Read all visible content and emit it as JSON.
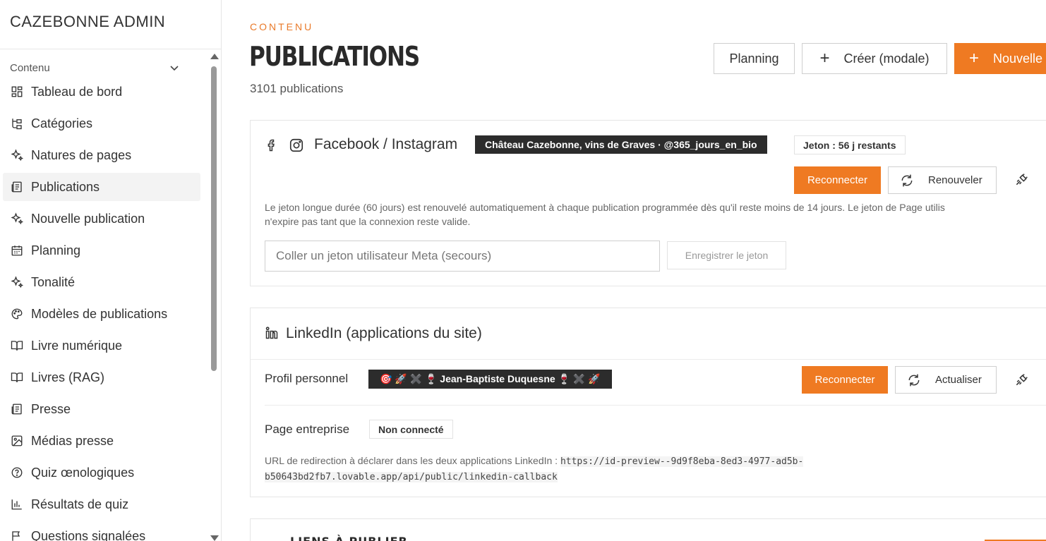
{
  "sidebar": {
    "brand": "CAZEBONNE ADMIN",
    "group_label": "Contenu",
    "items": [
      {
        "label": "Tableau de bord",
        "icon": "dashboard-icon"
      },
      {
        "label": "Catégories",
        "icon": "tree-icon"
      },
      {
        "label": "Natures de pages",
        "icon": "sparkles-icon"
      },
      {
        "label": "Publications",
        "icon": "newspaper-icon",
        "active": true
      },
      {
        "label": "Nouvelle publication",
        "icon": "sparkles-icon"
      },
      {
        "label": "Planning",
        "icon": "calendar-icon"
      },
      {
        "label": "Tonalité",
        "icon": "sparkles-icon"
      },
      {
        "label": "Modèles de publications",
        "icon": "palette-icon"
      },
      {
        "label": "Livre numérique",
        "icon": "book-icon"
      },
      {
        "label": "Livres (RAG)",
        "icon": "book-icon"
      },
      {
        "label": "Presse",
        "icon": "newspaper-icon"
      },
      {
        "label": "Médias presse",
        "icon": "image-icon"
      },
      {
        "label": "Quiz œnologiques",
        "icon": "help-circle-icon"
      },
      {
        "label": "Résultats de quiz",
        "icon": "bar-chart-icon"
      },
      {
        "label": "Questions signalées",
        "icon": "flag-icon"
      }
    ]
  },
  "header": {
    "eyebrow": "CONTENU",
    "title": "PUBLICATIONS",
    "count": "3101 publications",
    "planning_label": "Planning",
    "create_modal_label": "Créer (modale)",
    "new_label": "Nouvelle"
  },
  "facebook": {
    "title": "Facebook / Instagram",
    "account": "Château Cazebonne, vins de Graves · @365_jours_en_bio",
    "token_status": "Jeton : 56 j restants",
    "reconnect_label": "Reconnecter",
    "renew_label": "Renouveler",
    "help_line1": "Le jeton longue durée (60 jours) est renouvelé automatiquement à chaque publication programmée dès qu'il reste moins de 14 jours. Le jeton de Page utilis",
    "help_line2": "n'expire pas tant que la connexion reste valide.",
    "token_placeholder": "Coller un jeton utilisateur Meta (secours)",
    "save_token_label": "Enregistrer le jeton"
  },
  "linkedin": {
    "title": "LinkedIn (applications du site)",
    "personal_label": "Profil personnel",
    "personal_name": "🎯 🚀 ✖️ 🍷 Jean-Baptiste Duquesne 🍷 ✖️ 🚀",
    "reconnect_label": "Reconnecter",
    "refresh_label": "Actualiser",
    "company_label": "Page entreprise",
    "company_status": "Non connecté",
    "redirect_label": "URL de redirection à déclarer dans les deux applications LinkedIn :",
    "redirect_url_part1": "https://id-preview--9d9f8eba-8ed3-4977-ad5b-",
    "redirect_url_part2": "b50643bd2fb7.lovable.app/api/public/linkedin-callback"
  },
  "next_section": {
    "title": "LIENS À PUBLIER"
  },
  "colors": {
    "accent": "#ef7a22",
    "dark_badge": "#2c2c2c"
  }
}
